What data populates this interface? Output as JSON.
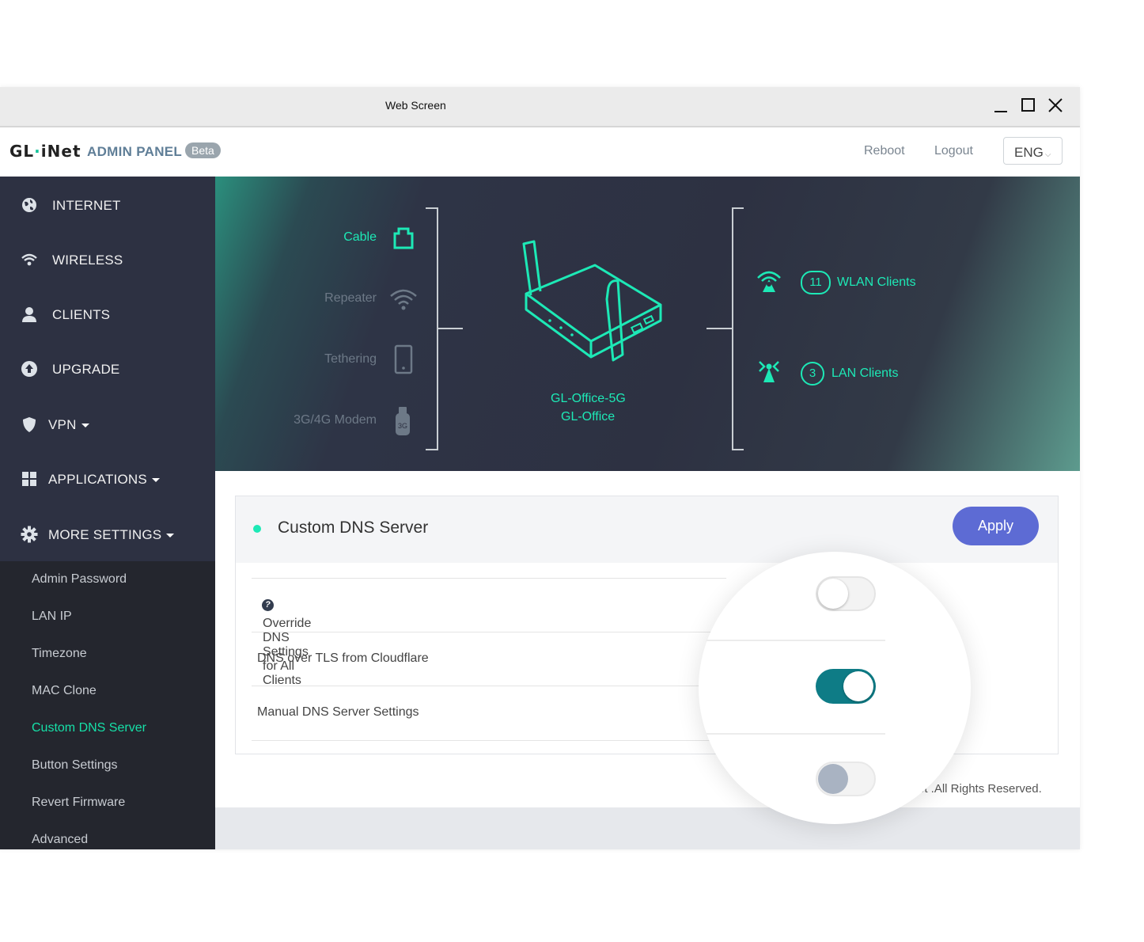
{
  "window": {
    "title": "Web Screen"
  },
  "header": {
    "logo": "GL·iNet",
    "admin_panel": "ADMIN PANEL",
    "beta": "Beta",
    "reboot": "Reboot",
    "logout": "Logout",
    "language": "ENG"
  },
  "sidebar": {
    "items": [
      {
        "label": "INTERNET",
        "icon": "globe-icon"
      },
      {
        "label": "WIRELESS",
        "icon": "wifi-icon"
      },
      {
        "label": "CLIENTS",
        "icon": "user-icon"
      },
      {
        "label": "UPGRADE",
        "icon": "upload-icon"
      },
      {
        "label": "VPN",
        "icon": "shield-icon"
      },
      {
        "label": "APPLICATIONS",
        "icon": "grid-icon"
      },
      {
        "label": "MORE SETTINGS",
        "icon": "gear-icon"
      }
    ],
    "submenu": [
      "Admin Password",
      "LAN IP",
      "Timezone",
      "MAC Clone",
      "Custom DNS Server",
      "Button Settings",
      "Revert Firmware",
      "Advanced"
    ],
    "active_submenu": "Custom DNS Server"
  },
  "hero": {
    "sources": [
      {
        "label": "Cable",
        "active": true,
        "icon": "ethernet-port-icon"
      },
      {
        "label": "Repeater",
        "active": false,
        "icon": "wifi-icon"
      },
      {
        "label": "Tethering",
        "active": false,
        "icon": "phone-icon"
      },
      {
        "label": "3G/4G Modem",
        "active": false,
        "icon": "usb-modem-icon"
      }
    ],
    "device_model": "GL-Office-5G",
    "device_name": "GL-Office",
    "wlan_count": "11",
    "wlan_label": "WLAN Clients",
    "lan_count": "3",
    "lan_label": "LAN Clients",
    "accent": "#1de9b6"
  },
  "card": {
    "title": "Custom DNS Server",
    "apply_label": "Apply",
    "rows": [
      {
        "label": "Override DNS Settings for All Clients",
        "help": "?",
        "enabled": false
      },
      {
        "label": "DNS over TLS from Cloudflare",
        "enabled": true
      },
      {
        "label": "Manual DNS Server Settings",
        "enabled": false,
        "disabled": true
      }
    ]
  },
  "footer": {
    "copyright": "et .All Rights Reserved."
  },
  "colors": {
    "sidebar": "#2d3142",
    "accent": "#1de9b6",
    "apply": "#5d6bd4",
    "toggle_on": "#0e7c86"
  }
}
